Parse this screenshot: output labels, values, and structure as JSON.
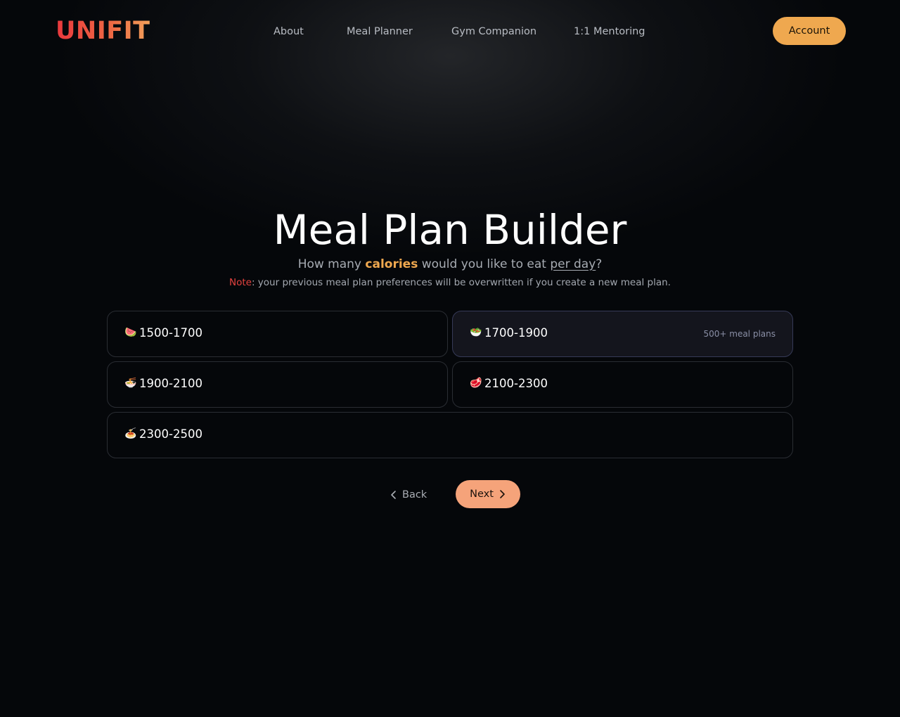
{
  "header": {
    "logo": "UNIFIT",
    "nav": [
      {
        "label": "About"
      },
      {
        "label": "Meal Planner"
      },
      {
        "label": "Gym Companion"
      },
      {
        "label": "1:1 Mentoring"
      }
    ],
    "account_label": "Account"
  },
  "main": {
    "title": "Meal Plan Builder",
    "subtitle": {
      "part1": "How many ",
      "accent": "calories",
      "part2": " would you like to eat ",
      "underlined": "per day",
      "part3": "?"
    },
    "note": {
      "label": "Note",
      "text": ": your previous meal plan preferences will be overwritten if you create a new meal plan."
    },
    "options": [
      {
        "emoji": "🍉",
        "icon": "watermelon-icon",
        "range": "1500-1700",
        "badge": "",
        "selected": false
      },
      {
        "emoji": "🥗",
        "icon": "salad-icon",
        "range": "1700-1900",
        "badge": "500+ meal plans",
        "selected": true
      },
      {
        "emoji": "🍜",
        "icon": "noodle-bowl-icon",
        "range": "1900-2100",
        "badge": "",
        "selected": false
      },
      {
        "emoji": "🥩",
        "icon": "steak-icon",
        "range": "2100-2300",
        "badge": "",
        "selected": false
      },
      {
        "emoji": "🍝",
        "icon": "pasta-icon",
        "range": "2300-2500",
        "badge": "",
        "selected": false
      }
    ],
    "back_label": "Back",
    "next_label": "Next"
  },
  "colors": {
    "background": "#05070a",
    "accent": "#efa84f",
    "next_button": "#f5a37a",
    "note_red": "#e5423f",
    "selected_card": "#14151d"
  }
}
